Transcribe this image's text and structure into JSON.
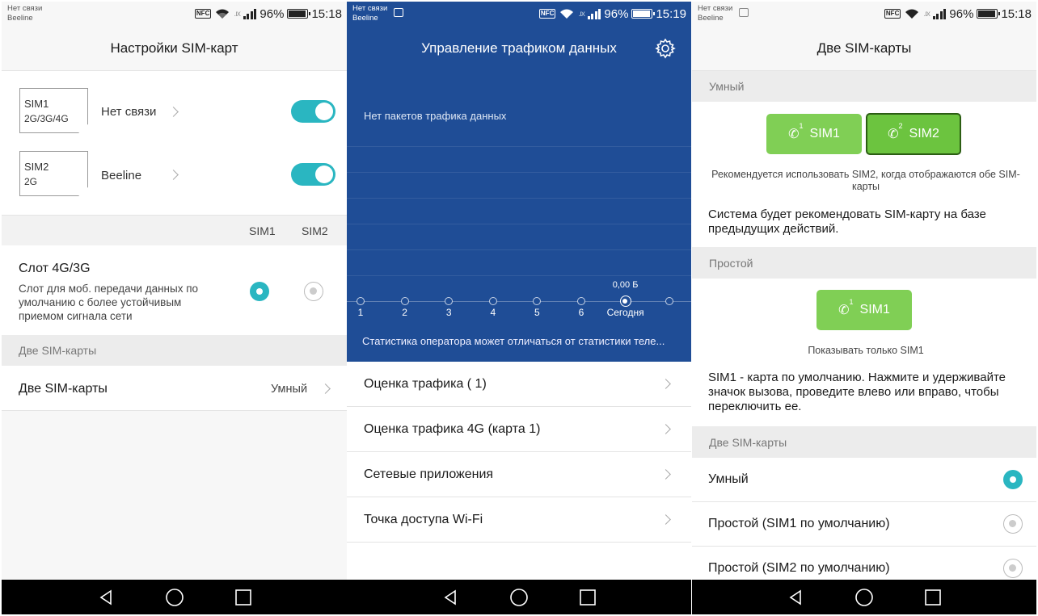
{
  "statusbar": {
    "carrier1": "Нет связи",
    "carrier2": "Beeline",
    "nfc": "NFC",
    "battery_pct": "96%",
    "time_s1": "15:18",
    "time_s2": "15:19",
    "time_s3": "15:18"
  },
  "screen1": {
    "title": "Настройки SIM-карт",
    "sim1": {
      "name": "SIM1",
      "type": "2G/3G/4G",
      "status": "Нет связи",
      "enabled": true
    },
    "sim2": {
      "name": "SIM2",
      "type": "2G",
      "status": "Beeline",
      "enabled": true
    },
    "col_sim1": "SIM1",
    "col_sim2": "SIM2",
    "slot_title": "Слот 4G/3G",
    "slot_desc": "Слот для моб. передачи данных по умолчанию с более устойчивым приемом сигнала сети",
    "section_dual": "Две SIM-карты",
    "dual_label": "Две SIM-карты",
    "dual_value": "Умный"
  },
  "screen2": {
    "title": "Управление трафиком данных",
    "no_packages": "Нет пакетов трафика данных",
    "chart_data": {
      "type": "line",
      "categories": [
        "1",
        "2",
        "3",
        "4",
        "5",
        "6",
        "Сегодня"
      ],
      "values": [
        0,
        0,
        0,
        0,
        0,
        0,
        0
      ],
      "value_label": "0,00 Б"
    },
    "note": "Статистика оператора может отличаться от статистики теле...",
    "menu": [
      "Оценка трафика ( 1)",
      "Оценка трафика 4G (карта 1)",
      "Сетевые приложения",
      "Точка доступа Wi-Fi"
    ]
  },
  "screen3": {
    "title": "Две SIM-карты",
    "section_smart": "Умный",
    "btn_sim1": "SIM1",
    "btn_sim2": "SIM2",
    "sup1": "1",
    "sup2": "2",
    "smart_hint": "Рекомендуется использовать SIM2, когда отображаются обе SIM-карты",
    "smart_desc": "Система будет рекомендовать SIM-карту на базе предыдущих действий.",
    "section_simple": "Простой",
    "simple_btn": "SIM1",
    "simple_hint": "Показывать только SIM1",
    "simple_desc": "SIM1 - карта по умолчанию. Нажмите и удерживайте значок вызова, проведите влево или вправо, чтобы переключить ее.",
    "section_dual": "Две SIM-карты",
    "options": [
      "Умный",
      "Простой (SIM1 по умолчанию)",
      "Простой (SIM2 по умолчанию)"
    ],
    "selected_option": 0
  },
  "colors": {
    "accent": "#2ab6c1",
    "blue": "#1f4d96",
    "green": "#80cf55"
  }
}
